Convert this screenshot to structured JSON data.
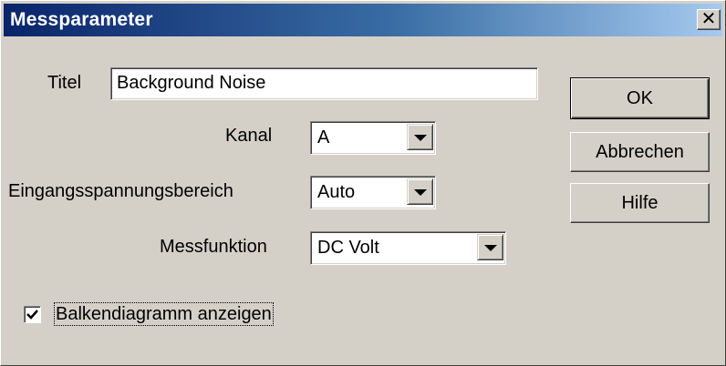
{
  "window": {
    "title": "Messparameter",
    "close_icon": "close-icon",
    "close_glyph": "✕"
  },
  "form": {
    "title_label": "Titel",
    "title_value": "Background Noise",
    "channel_label": "Kanal",
    "channel_value": "A",
    "range_label": "Eingangsspannungsbereich",
    "range_value": "Auto",
    "function_label": "Messfunktion",
    "function_value": "DC Volt",
    "checkbox_label": "Balkendiagramm anzeigen",
    "checkbox_checked": true
  },
  "buttons": {
    "ok": "OK",
    "cancel": "Abbrechen",
    "help": "Hilfe"
  },
  "colors": {
    "face": "#d4d0c8",
    "title_start": "#0a246a",
    "title_end": "#a6caf0"
  }
}
